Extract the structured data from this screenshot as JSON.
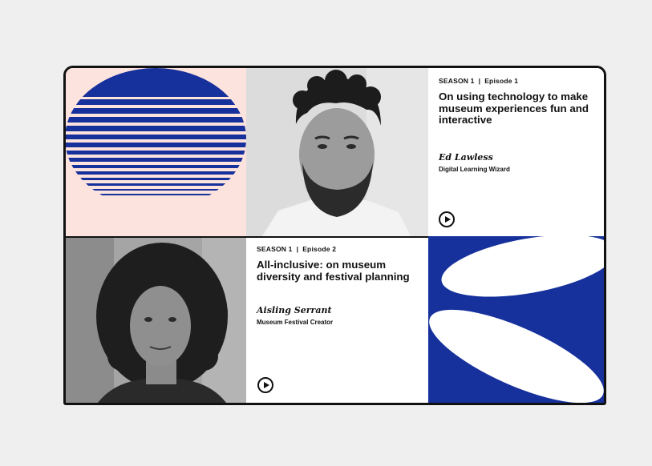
{
  "colors": {
    "page_bg": "#efefef",
    "blush": "#fde3dd",
    "royal_blue": "#16309c",
    "ink": "#111111"
  },
  "episodes": [
    {
      "season": "SEASON 1",
      "separator": "|",
      "episode": "Episode 1",
      "title": "On using technology to make museum experiences fun and interactive",
      "guest_name": "Ed Lawless",
      "guest_role": "Digital Learning Wizard",
      "play_icon": "play-circle-icon"
    },
    {
      "season": "SEASON 1",
      "separator": "|",
      "episode": "Episode 2",
      "title": "All-inclusive: on museum diversity and festival planning",
      "guest_name": "Aisling Serrant",
      "guest_role": "Museum Festival Creator",
      "play_icon": "play-circle-icon"
    }
  ]
}
